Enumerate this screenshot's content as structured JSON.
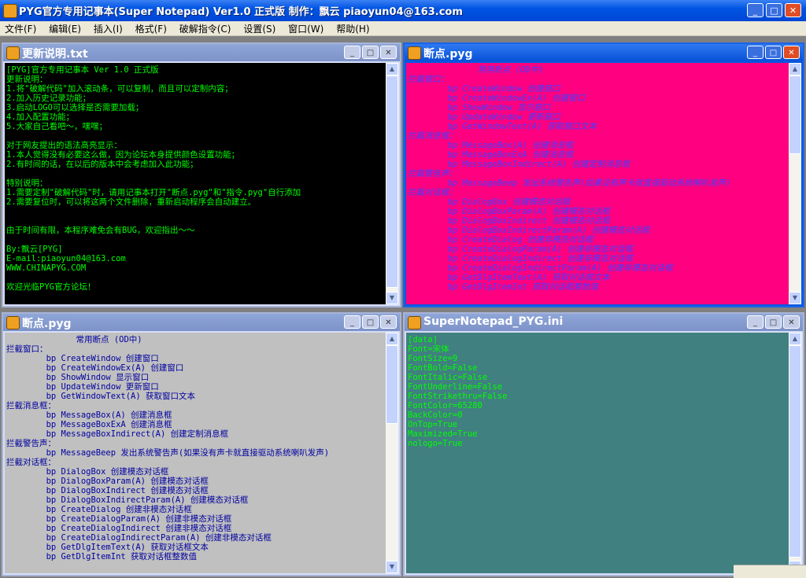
{
  "app": {
    "title": "PYG官方专用记事本(Super Notepad) Ver1.0 正式版  制作：飘云  piaoyun04@163.com"
  },
  "window_buttons": {
    "minimize": "_",
    "maximize": "□",
    "close": "✕"
  },
  "menu": [
    "文件(F)",
    "编辑(E)",
    "插入(I)",
    "格式(F)",
    "破解指令(C)",
    "设置(S)",
    "窗口(W)",
    "帮助(H)"
  ],
  "windows": [
    {
      "title": "更新说明.txt",
      "bg": "#000000",
      "fg": "#00ff00",
      "content": "[PYG]官方专用记事本 Ver 1.0 正式版\n更新说明：\n1.将\"破解代码\"加入滚动条，可以复制，而且可以定制内容；\n2.加入历史记录功能；\n3.启动LOGO可以选择是否需要加载；\n4.加入配置功能；\n5.大家自己看吧～，嘿嘿；\n\n对于网友提出的语法高亮显示：\n1.本人觉得没有必要这么做，因为论坛本身提供颜色设置功能；\n2.有时间的话，在以后的版本中会考虑加入此功能；\n\n特别说明：\n1.需要定制\"破解代码\"时，请用记事本打开\"断点.pyg\"和\"指令.pyg\"自行添加\n2.需要复位时，可以将这两个文件删除，重新启动程序会自动建立。\n\n\n由于时间有限，本程序难免会有BUG，欢迎指出～～\n\nBy:飘云[PYG]\nE-mail:piaoyun04@163.com\nWWW.CHINAPYG.COM\n\n欢迎光临PYG官方论坛！"
    },
    {
      "title": "断点.pyg",
      "bg": "#ff0080",
      "fg": "#4040ff",
      "content": "              常用断点 (OD中)\n拦截窗口：\n        bp CreateWindow 创建窗口\n        bp CreateWindowEx(A) 创建窗口\n        bp ShowWindow 显示窗口\n        bp UpdateWindow 更新窗口\n        bp GetWindowText(A) 获取窗口文本\n拦截消息框：\n        bp MessageBox(A) 创建消息框\n        bp MessageBoxExA 创建消息框\n        bp MessageBoxIndirect(A) 创建定制消息框\n拦截警告声：\n        bp MessageBeep 发出系统警告声(如果没有声卡就直接驱动系统喇叭发声)\n拦截对话框：\n        bp DialogBox 创建模态对话框\n        bp DialogBoxParam(A) 创建模态对话框\n        bp DialogBoxIndirect 创建模态对话框\n        bp DialogBoxIndirectParam(A) 创建模态对话框\n        bp CreateDialog 创建非模态对话框\n        bp CreateDialogParam(A) 创建非模态对话框\n        bp CreateDialogIndirect 创建非模态对话框\n        bp CreateDialogIndirectParam(A) 创建非模态对话框\n        bp GetDlgItemText(A) 获取对话框文本\n        bp GetDlgItemInt 获取对话框整数值"
    },
    {
      "title": "断点.pyg",
      "bg": "#c0c0c0",
      "fg": "#0000a0",
      "content": "              常用断点 (OD中)\n拦截窗口：\n        bp CreateWindow 创建窗口\n        bp CreateWindowEx(A) 创建窗口\n        bp ShowWindow 显示窗口\n        bp UpdateWindow 更新窗口\n        bp GetWindowText(A) 获取窗口文本\n拦截消息框：\n        bp MessageBox(A) 创建消息框\n        bp MessageBoxExA 创建消息框\n        bp MessageBoxIndirect(A) 创建定制消息框\n拦截警告声：\n        bp MessageBeep 发出系统警告声(如果没有声卡就直接驱动系统喇叭发声)\n拦截对话框：\n        bp DialogBox 创建模态对话框\n        bp DialogBoxParam(A) 创建模态对话框\n        bp DialogBoxIndirect 创建模态对话框\n        bp DialogBoxIndirectParam(A) 创建模态对话框\n        bp CreateDialog 创建非模态对话框\n        bp CreateDialogParam(A) 创建非模态对话框\n        bp CreateDialogIndirect 创建非模态对话框\n        bp CreateDialogIndirectParam(A) 创建非模态对话框\n        bp GetDlgItemText(A) 获取对话框文本\n        bp GetDlgItemInt 获取对话框整数值"
    },
    {
      "title": "SuperNotepad_PYG.ini",
      "bg": "#408080",
      "fg": "#00ff00",
      "content": "[data]\nFont=宋体\nFontSize=9\nFontBold=False\nFontItalic=False\nFontUnderline=False\nFontStrikethru=False\nFontColor=65280\nBackColor=0\nOnTop=True\nMaximized=True\nnologo=True"
    }
  ]
}
